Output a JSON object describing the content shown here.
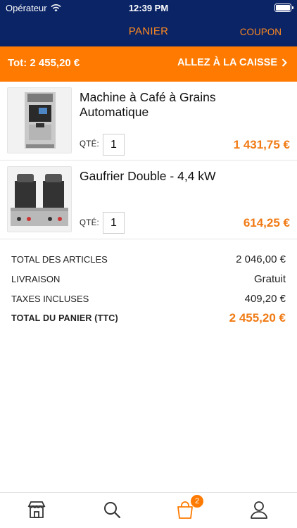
{
  "status_bar": {
    "carrier": "Opérateur",
    "time": "12:39 PM"
  },
  "header": {
    "title": "PANIER",
    "coupon_label": "COUPON"
  },
  "checkout": {
    "total_label": "Tot: 2 455,20 €",
    "cta_label": "ALLEZ À LA CAISSE"
  },
  "cart": {
    "items": [
      {
        "name": "Machine à Café à Grains Automatique",
        "qty_label": "QTÉ:",
        "qty": "1",
        "price": "1 431,75 €",
        "image": "coffee-machine"
      },
      {
        "name": "Gaufrier Double - 4,4 kW",
        "qty_label": "QTÉ:",
        "qty": "1",
        "price": "614,25 €",
        "image": "waffle-maker"
      }
    ]
  },
  "summary": {
    "subtotal_label": "TOTAL DES ARTICLES",
    "subtotal_value": "2 046,00 €",
    "shipping_label": "LIVRAISON",
    "shipping_value": "Gratuit",
    "tax_label": "TAXES INCLUSES",
    "tax_value": "409,20 €",
    "total_label": "TOTAL DU PANIER (TTC)",
    "total_value": "2 455,20 €"
  },
  "tabbar": {
    "tabs": [
      {
        "icon": "store-icon",
        "active": false
      },
      {
        "icon": "search-icon",
        "active": false
      },
      {
        "icon": "shopping-bag-icon",
        "active": true,
        "badge": "2"
      },
      {
        "icon": "user-icon",
        "active": false
      }
    ]
  },
  "colors": {
    "navy": "#0b2466",
    "orange": "#ff7a00",
    "price_orange": "#f07a14"
  }
}
